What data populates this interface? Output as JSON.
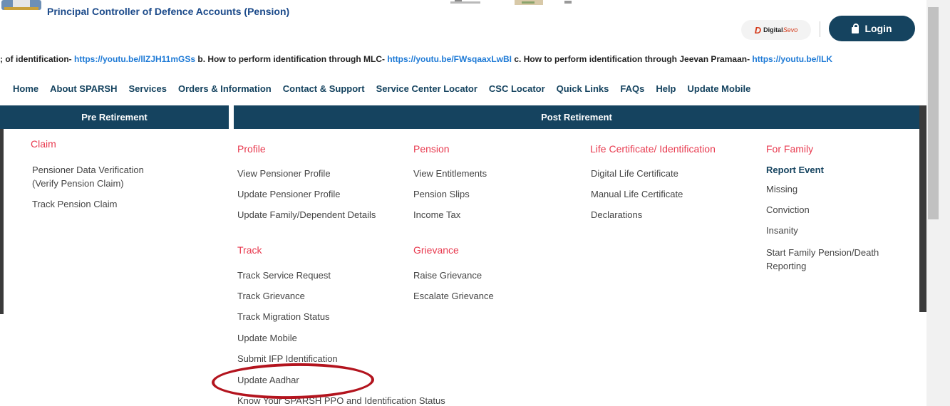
{
  "header": {
    "org_name": "Principal Controller of Defence Accounts (Pension)",
    "digisevo_brand_bold": "Digital",
    "digisevo_brand_italic": "Sevo",
    "login_label": "Login"
  },
  "ticker": {
    "p1": "; of identification- ",
    "l1": "https://youtu.be/llZJH11mGSs",
    "p2": "  b. How to perform identification through MLC- ",
    "l2": "https://youtu.be/FWsqaaxLwBI",
    "p3": "  c. How to perform identification through Jeevan Pramaan- ",
    "l3": "https://youtu.be/ILK"
  },
  "nav": [
    "Home",
    "About SPARSH",
    "Services",
    "Orders & Information",
    "Contact & Support",
    "Service Center Locator",
    "CSC Locator",
    "Quick Links",
    "FAQs",
    "Help",
    "Update Mobile"
  ],
  "menu": {
    "pre_title": "Pre Retirement",
    "post_title": "Post Retirement",
    "claim": {
      "title": "Claim",
      "items": [
        "Pensioner Data Verification",
        "(Verify Pension Claim)",
        "Track Pension Claim"
      ]
    },
    "profile": {
      "title": "Profile",
      "items": [
        "View Pensioner Profile",
        "Update Pensioner Profile",
        "Update Family/Dependent Details"
      ]
    },
    "pension": {
      "title": "Pension",
      "items": [
        "View Entitlements",
        "Pension Slips",
        "Income Tax"
      ]
    },
    "life": {
      "title": "Life Certificate/ Identification",
      "items": [
        "Digital Life Certificate",
        "Manual Life Certificate",
        "Declarations"
      ]
    },
    "family": {
      "title": "For Family",
      "report": "Report Event",
      "items": [
        "Missing",
        "Conviction",
        "Insanity",
        "Start Family Pension/Death",
        "Reporting"
      ]
    },
    "track": {
      "title": "Track",
      "items": [
        "Track Service Request",
        "Track Grievance",
        "Track Migration Status",
        "Update Mobile",
        "Submit IFP Identification",
        "Update Aadhar",
        "Know Your SPARSH PPO and Identification Status"
      ]
    },
    "grievance": {
      "title": "Grievance",
      "items": [
        "Raise Grievance",
        "Escalate Grievance"
      ]
    }
  },
  "colors": {
    "navy": "#15435f",
    "accent_red": "#e83a4f",
    "link_blue": "#1e7ad6",
    "highlight": "#b3141e"
  }
}
